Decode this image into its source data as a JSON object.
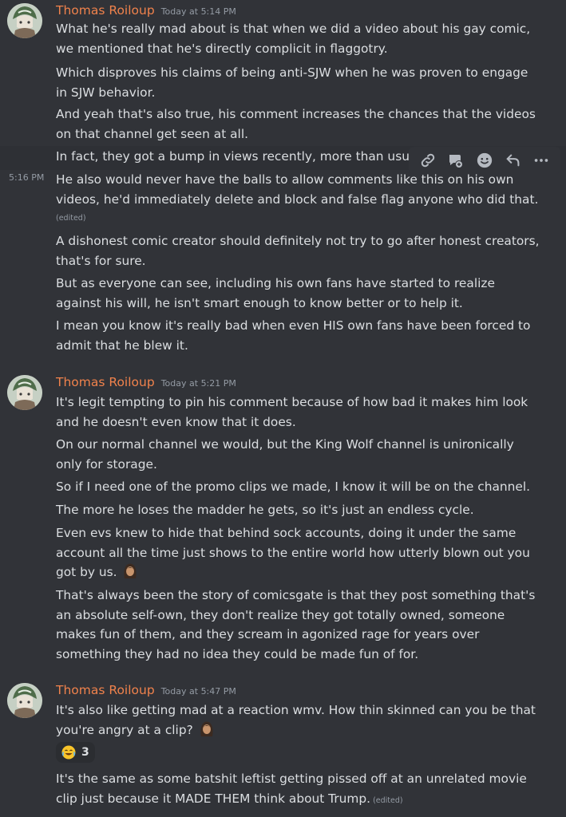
{
  "colors": {
    "background": "#313338",
    "username": "#f0824c",
    "timestamp": "#949ba4",
    "text": "#dbdee1"
  },
  "groups": [
    {
      "author": "Thomas Roiloup",
      "timestamp": "Today at 5:14 PM",
      "messages": [
        "What he's really mad about is that when we did a video about his gay comic, we mentioned that he's directly complicit in flaggotry.",
        "Which disproves his claims of being anti-SJW when he was proven to engage in SJW behavior.",
        "And yeah that's also true, his comment increases the chances that the videos on that channel get seen at all.",
        "In fact, they got a bump in views recently, more than usual.",
        "He also would never have the balls to allow comments like this on his own videos, he'd immediately delete and block and false flag anyone who did that.",
        "A dishonest comic creator should definitely not try to go after honest creators, that's for sure.",
        "But as everyone can see, including his own fans have started to realize against his will, he isn't smart enough to know better or to help it.",
        "I mean you know it's really bad when even HIS own fans have been forced to admit that he blew it."
      ],
      "side_timestamp": "5:16 PM",
      "edited_label": "(edited)"
    },
    {
      "author": "Thomas Roiloup",
      "timestamp": "Today at 5:21 PM",
      "messages": [
        "It's legit tempting to pin his comment because of how bad it makes him look and he doesn't even know that it does.",
        "On our normal channel we would, but the King Wolf channel is unironically only for storage.",
        "So if I need one of the promo clips we made, I know it will be on the channel.",
        "The more he loses the madder he gets, so it's just an endless cycle.",
        "Even evs knew to hide that behind sock accounts, doing it under the same account all the time just shows to the entire world how utterly blown out you got by us.",
        "That's always been the story of comicsgate is that they post something that's an absolute self-own, they don't realize they got totally owned, someone makes fun of them, and they scream in agonized rage for years over something they had no idea they could be made fun of for."
      ]
    },
    {
      "author": "Thomas Roiloup",
      "timestamp": "Today at 5:47 PM",
      "messages": [
        "It's also like getting mad at a reaction wmv.  How thin skinned can you be that you're angry at a clip?",
        "It's the same as some batshit leftist getting pissed off at an unrelated movie clip just because it MADE THEM think about Trump."
      ],
      "reaction": {
        "emoji": "joy-emoji",
        "count": "3"
      },
      "edited_label": "(edited)"
    }
  ],
  "toolbar": {
    "icons": [
      "link-icon",
      "thread-icon",
      "add-reaction-icon",
      "reply-icon",
      "more-icon"
    ]
  }
}
